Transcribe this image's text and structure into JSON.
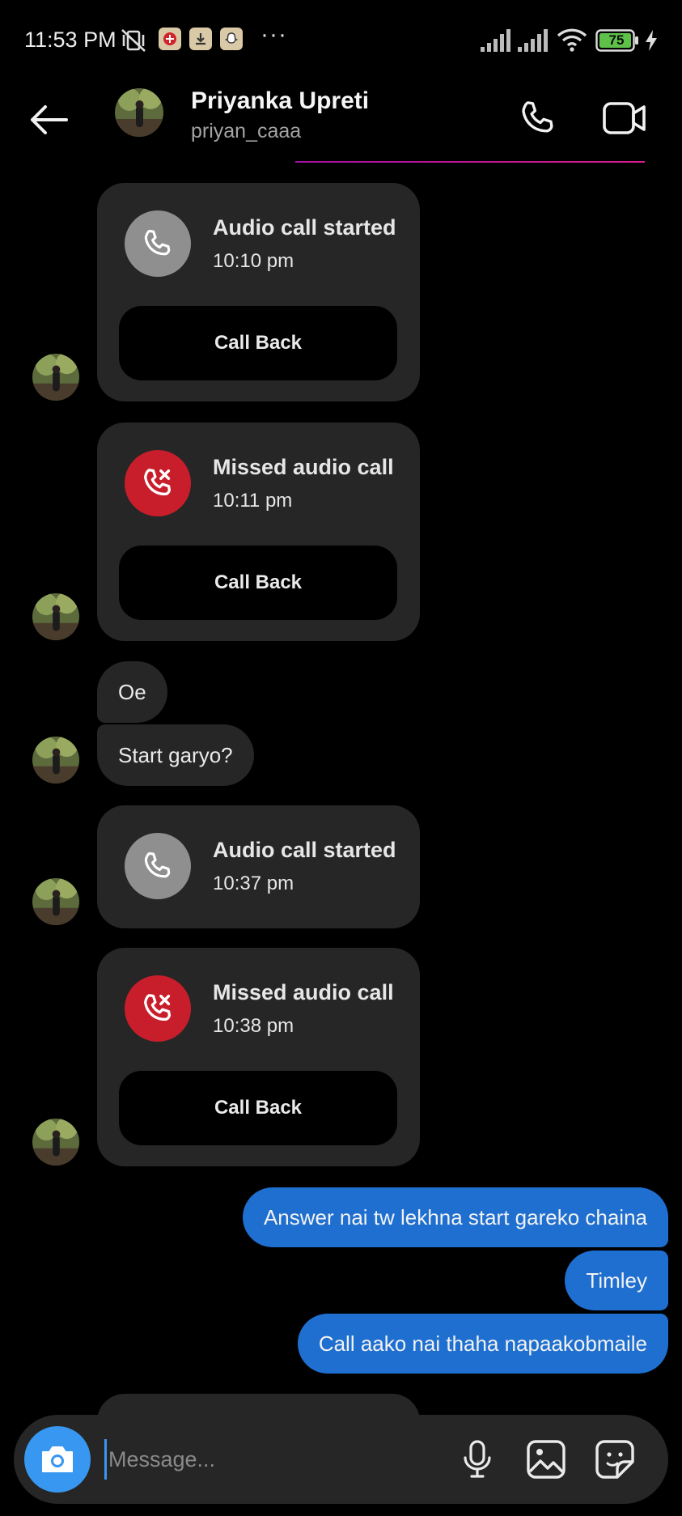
{
  "status_bar": {
    "time": "11:53 PM",
    "battery": "75",
    "overflow": "···"
  },
  "header": {
    "name": "Priyanka Upreti",
    "username": "priyan_caaa",
    "icons": [
      "back-arrow-icon",
      "phone-icon",
      "video-camera-icon"
    ]
  },
  "messages": {
    "call1": {
      "title": "Audio call started",
      "time": "10:10 pm",
      "button": "Call Back"
    },
    "call2": {
      "title": "Missed audio call",
      "time": "10:11 pm",
      "button": "Call Back"
    },
    "text1": "Oe",
    "text2": "Start garyo?",
    "call3": {
      "title": "Audio call started",
      "time": "10:37 pm"
    },
    "call4": {
      "title": "Missed audio call",
      "time": "10:38 pm",
      "button": "Call Back"
    },
    "out1": "Answer nai tw lekhna start gareko chaina",
    "out2": "Timley",
    "out3": "Call aako nai thaha napaakobmaile"
  },
  "composer": {
    "placeholder": "Message...",
    "icons": [
      "camera-icon",
      "microphone-icon",
      "gallery-icon",
      "sticker-icon"
    ]
  },
  "colors": {
    "background": "#000000",
    "incoming_bubble": "#262626",
    "outgoing_bubble": "#1e6fd0",
    "missed_call": "#c81e2b",
    "camera_button": "#3897f0"
  }
}
